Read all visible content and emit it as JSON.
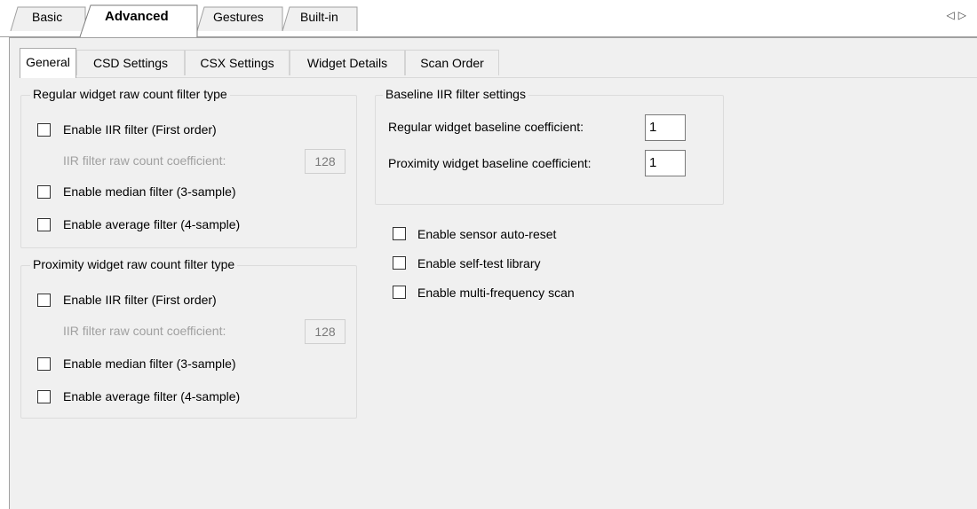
{
  "top_tabs": [
    {
      "label": "Basic",
      "active": false
    },
    {
      "label": "Advanced",
      "active": true
    },
    {
      "label": "Gestures",
      "active": false
    },
    {
      "label": "Built-in",
      "active": false
    }
  ],
  "scroll_arrows": {
    "left": "◁",
    "right": "▷"
  },
  "sub_tabs": [
    {
      "label": "General",
      "active": true
    },
    {
      "label": "CSD Settings",
      "active": false
    },
    {
      "label": "CSX Settings",
      "active": false
    },
    {
      "label": "Widget Details",
      "active": false
    },
    {
      "label": "Scan Order",
      "active": false
    }
  ],
  "regular_filter": {
    "title": "Regular widget raw count filter type",
    "iir_label": "Enable IIR filter (First order)",
    "iir_checked": false,
    "iir_coeff_label": "IIR filter raw count coefficient:",
    "iir_coeff_value": "128",
    "median_label": "Enable median filter (3-sample)",
    "median_checked": false,
    "average_label": "Enable average filter (4-sample)",
    "average_checked": false
  },
  "proximity_filter": {
    "title": "Proximity widget raw count filter type",
    "iir_label": "Enable IIR filter (First order)",
    "iir_checked": false,
    "iir_coeff_label": "IIR filter raw count coefficient:",
    "iir_coeff_value": "128",
    "median_label": "Enable median filter (3-sample)",
    "median_checked": false,
    "average_label": "Enable average filter (4-sample)",
    "average_checked": false
  },
  "baseline": {
    "title": "Baseline IIR filter settings",
    "regular_label": "Regular widget baseline coefficient:",
    "regular_value": "1",
    "proximity_label": "Proximity widget baseline coefficient:",
    "proximity_value": "1"
  },
  "options": {
    "auto_reset_label": "Enable sensor auto-reset",
    "auto_reset_checked": false,
    "self_test_label": "Enable self-test library",
    "self_test_checked": false,
    "multi_freq_label": "Enable multi-frequency scan",
    "multi_freq_checked": false
  }
}
